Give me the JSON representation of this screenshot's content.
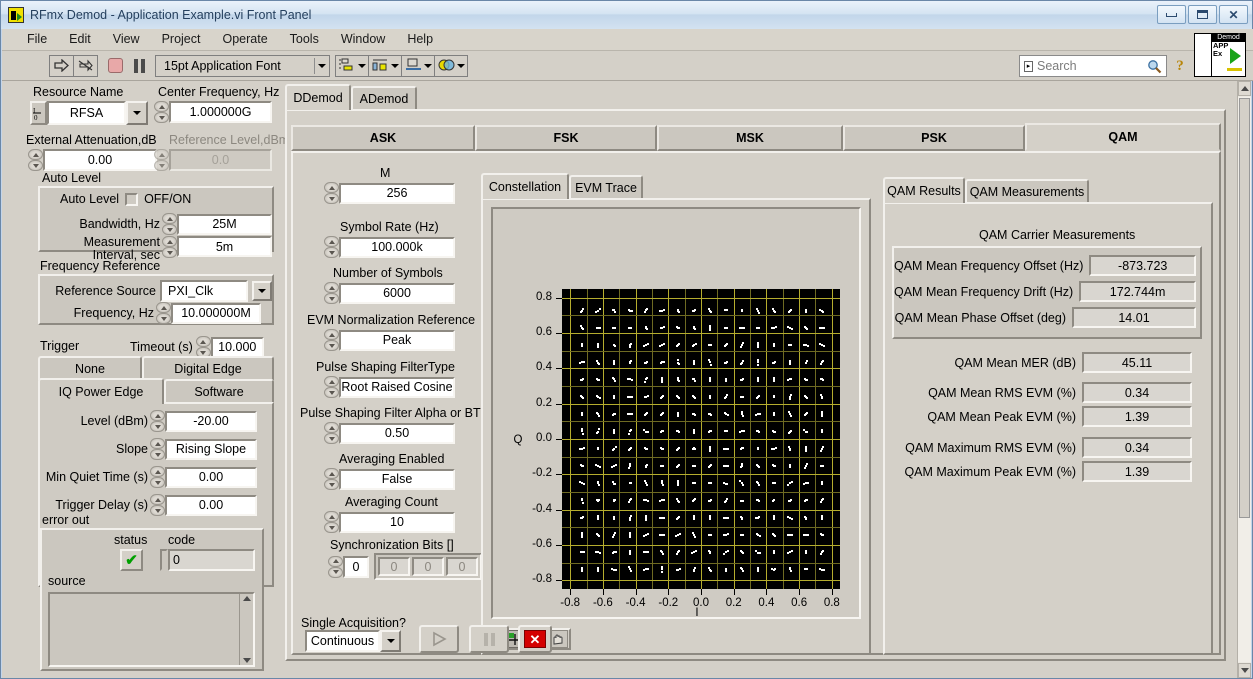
{
  "window": {
    "title": "RFmx Demod - Application Example.vi Front Panel",
    "minimize_label": "Minimize",
    "maximize_label": "Maximize",
    "close_label": "Close"
  },
  "menu": {
    "items": [
      "File",
      "Edit",
      "View",
      "Project",
      "Operate",
      "Tools",
      "Window",
      "Help"
    ]
  },
  "toolbar": {
    "run_icon": "run-arrow-icon",
    "run_continuous_icon": "run-continuous-icon",
    "abort_icon": "abort-stop-icon",
    "pause_icon": "pause-icon",
    "font_selector": "15pt Application Font",
    "align_icon": "align-objects-icon",
    "distribute_icon": "distribute-objects-icon",
    "resize_icon": "resize-objects-icon",
    "reorder_icon": "reorder-objects-icon",
    "help_icon": "context-help-icon"
  },
  "search": {
    "placeholder": "Search",
    "icon": "magnifier-icon"
  },
  "vi_icon": {
    "banner": "Demod",
    "line1": "APP",
    "line2": "Ex"
  },
  "instrument": {
    "resource_name": {
      "label": "Resource Name",
      "value": "RFSA",
      "io_glyph": "I/O"
    },
    "center_frequency": {
      "label": "Center Frequency, Hz",
      "value": "1.000000G"
    },
    "external_attenuation": {
      "label": "External Attenuation,dB",
      "value": "0.00"
    },
    "reference_level": {
      "label": "Reference Level,dBm",
      "value": "0.0",
      "disabled": true
    }
  },
  "auto_level": {
    "group_title": "Auto Level",
    "toggle_label": "Auto Level",
    "toggle_state_text": "OFF/ON",
    "checked": false,
    "bandwidth": {
      "label": "Bandwidth, Hz",
      "value": "25M"
    },
    "measurement_interval": {
      "label_line1": "Measurement",
      "label_line2": "Interval, sec",
      "value": "5m"
    }
  },
  "frequency_reference": {
    "group_title": "Frequency Reference",
    "reference_source": {
      "label": "Reference Source",
      "value": "PXI_Clk"
    },
    "frequency": {
      "label": "Frequency, Hz",
      "value": "10.000000M"
    }
  },
  "trigger": {
    "group_title": "Trigger",
    "timeout": {
      "label": "Timeout (s)",
      "value": "10.000"
    },
    "tabs": [
      "None",
      "Digital Edge",
      "IQ Power Edge",
      "Software"
    ],
    "selected_tab": "IQ Power Edge",
    "level": {
      "label": "Level (dBm)",
      "value": "-20.00"
    },
    "slope": {
      "label": "Slope",
      "value": "Rising Slope"
    },
    "min_quiet_time": {
      "label": "Min Quiet Time (s)",
      "value": "0.00"
    },
    "trigger_delay": {
      "label": "Trigger Delay (s)",
      "value": "0.00"
    }
  },
  "error_out": {
    "group_title": "error out",
    "status_label": "status",
    "status_ok": true,
    "code_label": "code",
    "code_value": "0",
    "source_label": "source",
    "source_value": ""
  },
  "demod_tabs": {
    "items": [
      "DDemod",
      "ADemod"
    ],
    "selected": "DDemod"
  },
  "modulation_tabs": {
    "items": [
      "ASK",
      "FSK",
      "MSK",
      "PSK",
      "QAM"
    ],
    "selected": "QAM"
  },
  "qam_settings": {
    "m": {
      "label": "M",
      "value": "256"
    },
    "symbol_rate": {
      "label": "Symbol Rate (Hz)",
      "value": "100.000k"
    },
    "number_of_symbols": {
      "label": "Number of Symbols",
      "value": "6000"
    },
    "evm_normalization_reference": {
      "label": "EVM Normalization Reference",
      "value": "Peak"
    },
    "pulse_shaping_filter_type": {
      "label": "Pulse Shaping FilterType",
      "value": "Root Raised Cosine"
    },
    "pulse_shaping_filter_alpha": {
      "label": "Pulse Shaping Filter Alpha or BT",
      "value": "0.50"
    },
    "averaging_enabled": {
      "label": "Averaging Enabled",
      "value": "False"
    },
    "averaging_count": {
      "label": "Averaging Count",
      "value": "10"
    },
    "synchronization_bits": {
      "label": "Synchronization Bits []",
      "index": "0",
      "cells": [
        "0",
        "0",
        "0"
      ]
    }
  },
  "graph_tabs": {
    "items": [
      "Constellation",
      "EVM Trace"
    ],
    "selected": "Constellation"
  },
  "chart_data": {
    "type": "scatter",
    "title": "Constellation",
    "xlabel": "I",
    "ylabel": "Q",
    "xlim": [
      -0.85,
      0.85
    ],
    "ylim": [
      -0.85,
      0.85
    ],
    "xticks": [
      -0.8,
      -0.6,
      -0.4,
      -0.2,
      0.0,
      0.2,
      0.4,
      0.6,
      0.8
    ],
    "yticks": [
      -0.8,
      -0.6,
      -0.4,
      -0.2,
      0.0,
      0.2,
      0.4,
      0.6,
      0.8
    ],
    "grid": true,
    "grid_minor_step": 0.1,
    "grid_major_step": 0.2,
    "background": "#000000",
    "grid_color": "#6e6a22",
    "grid_major_color": "#b5ad2e",
    "marker_color": "#ffffff",
    "modulation": "256-QAM",
    "constellation_levels": [
      -0.7333,
      -0.6356,
      -0.5378,
      -0.44,
      -0.3422,
      -0.2444,
      -0.1467,
      -0.0489,
      0.0489,
      0.1467,
      0.2444,
      0.3422,
      0.44,
      0.5378,
      0.6356,
      0.7333
    ],
    "points_per_symbol": 3,
    "total_points": 768,
    "note": "256-QAM constellation: 16 x 16 symbol grid, small white clusters at each ideal symbol location"
  },
  "graph_toolbar": {
    "cursor_icon": "cursor-crosshair-icon",
    "zoom_icon": "zoom-magnifier-icon",
    "pan_icon": "pan-hand-icon"
  },
  "results_tabs": {
    "items": [
      "QAM Results",
      "QAM Measurements"
    ],
    "selected": "QAM Results"
  },
  "qam_results": {
    "carrier_group_title": "QAM Carrier Measurements",
    "carrier_rows": [
      {
        "label": "QAM Mean Frequency Offset (Hz)",
        "value": "-873.723"
      },
      {
        "label": "QAM Mean Frequency Drift (Hz)",
        "value": "172.744m"
      },
      {
        "label": "QAM Mean Phase Offset (deg)",
        "value": "14.01"
      }
    ],
    "mer_row": {
      "label": "QAM Mean MER (dB)",
      "value": "45.11"
    },
    "mean_rows": [
      {
        "label": "QAM Mean RMS EVM (%)",
        "value": "0.34"
      },
      {
        "label": "QAM Mean Peak EVM (%)",
        "value": "1.39"
      }
    ],
    "max_rows": [
      {
        "label": "QAM Maximum RMS EVM (%)",
        "value": "0.34"
      },
      {
        "label": "QAM Maximum Peak EVM (%)",
        "value": "1.39"
      }
    ]
  },
  "acquisition": {
    "label": "Single Acquisition?",
    "value": "Continuous",
    "run_icon": "play-triangle-icon",
    "pause_icon": "pause-bars-icon",
    "stop_icon": "stop-x-icon"
  }
}
